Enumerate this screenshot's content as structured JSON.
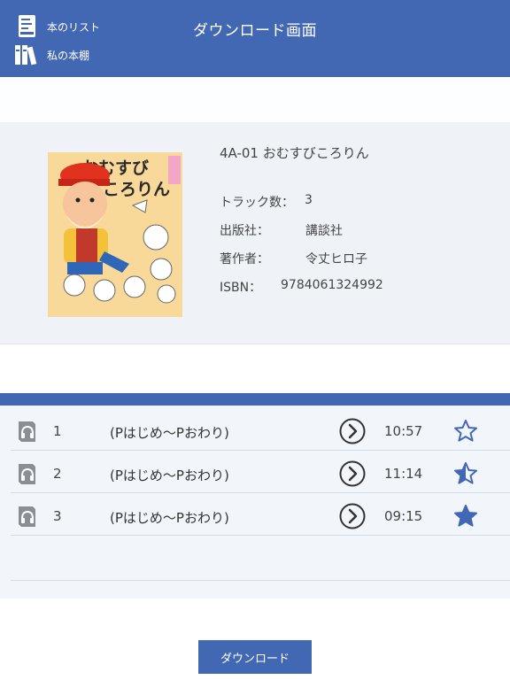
{
  "header": {
    "title": "ダウンロード画面",
    "nav": [
      {
        "label": "本のリスト",
        "icon": "book-list-icon"
      },
      {
        "label": "私の本棚",
        "icon": "bookshelf-icon"
      }
    ]
  },
  "book": {
    "title": "4A-01 おむすびころりん",
    "cover_title": "おむすびころりん",
    "fields": [
      {
        "label": "トラック数：",
        "value": "3"
      },
      {
        "label": "出版社：",
        "value": "講談社"
      },
      {
        "label": "著作者：",
        "value": "令丈ヒロ子"
      },
      {
        "label": "ISBN：",
        "value": "9784061324992"
      }
    ]
  },
  "tracks": [
    {
      "num": "1",
      "title": "(Pはじめ～Pおわり)",
      "duration": "10:57",
      "star": "empty"
    },
    {
      "num": "2",
      "title": "(Pはじめ～Pおわり)",
      "duration": "11:14",
      "star": "half"
    },
    {
      "num": "3",
      "title": "(Pはじめ～Pおわり)",
      "duration": "09:15",
      "star": "full"
    }
  ],
  "download_label": "ダウンロード",
  "colors": {
    "accent": "#4368b3",
    "panel": "#eff3f8",
    "icon_gray": "#8a8f96"
  }
}
